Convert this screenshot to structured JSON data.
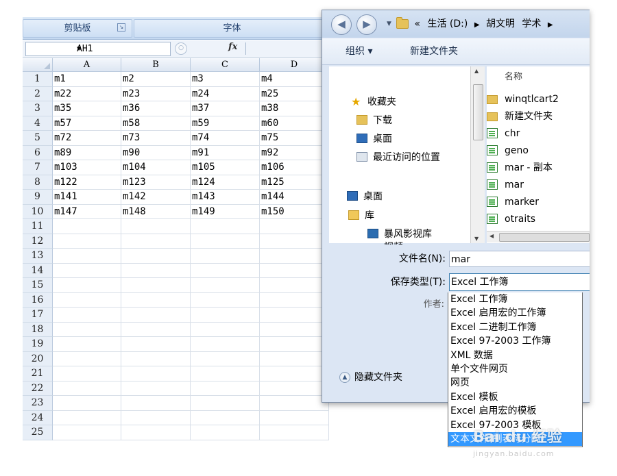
{
  "excel": {
    "ribbon": {
      "clipboard": "剪贴板",
      "font": "字体",
      "launcher_icon": "dialog-launcher-icon"
    },
    "name_box": "AH1",
    "fx_label": "fx",
    "columns": [
      "A",
      "B",
      "C",
      "D"
    ],
    "rows": [
      {
        "num": "1",
        "cells": [
          "m1",
          "m2",
          "m3",
          "m4"
        ]
      },
      {
        "num": "2",
        "cells": [
          "m22",
          "m23",
          "m24",
          "m25"
        ]
      },
      {
        "num": "3",
        "cells": [
          "m35",
          "m36",
          "m37",
          "m38"
        ]
      },
      {
        "num": "4",
        "cells": [
          "m57",
          "m58",
          "m59",
          "m60"
        ]
      },
      {
        "num": "5",
        "cells": [
          "m72",
          "m73",
          "m74",
          "m75"
        ]
      },
      {
        "num": "6",
        "cells": [
          "m89",
          "m90",
          "m91",
          "m92"
        ]
      },
      {
        "num": "7",
        "cells": [
          "m103",
          "m104",
          "m105",
          "m106"
        ]
      },
      {
        "num": "8",
        "cells": [
          "m122",
          "m123",
          "m124",
          "m125"
        ]
      },
      {
        "num": "9",
        "cells": [
          "m141",
          "m142",
          "m143",
          "m144"
        ]
      },
      {
        "num": "10",
        "cells": [
          "m147",
          "m148",
          "m149",
          "m150"
        ]
      },
      {
        "num": "11",
        "cells": [
          "",
          "",
          "",
          ""
        ]
      },
      {
        "num": "12",
        "cells": [
          "",
          "",
          "",
          ""
        ]
      },
      {
        "num": "13",
        "cells": [
          "",
          "",
          "",
          ""
        ]
      },
      {
        "num": "14",
        "cells": [
          "",
          "",
          "",
          ""
        ]
      },
      {
        "num": "15",
        "cells": [
          "",
          "",
          "",
          ""
        ]
      },
      {
        "num": "16",
        "cells": [
          "",
          "",
          "",
          ""
        ]
      },
      {
        "num": "17",
        "cells": [
          "",
          "",
          "",
          ""
        ]
      },
      {
        "num": "18",
        "cells": [
          "",
          "",
          "",
          ""
        ]
      },
      {
        "num": "19",
        "cells": [
          "",
          "",
          "",
          ""
        ]
      },
      {
        "num": "20",
        "cells": [
          "",
          "",
          "",
          ""
        ]
      },
      {
        "num": "21",
        "cells": [
          "",
          "",
          "",
          ""
        ]
      },
      {
        "num": "22",
        "cells": [
          "",
          "",
          "",
          ""
        ]
      },
      {
        "num": "23",
        "cells": [
          "",
          "",
          "",
          ""
        ]
      },
      {
        "num": "24",
        "cells": [
          "",
          "",
          "",
          ""
        ]
      },
      {
        "num": "25",
        "cells": [
          "",
          "",
          "",
          ""
        ]
      }
    ]
  },
  "dialog": {
    "breadcrumb": {
      "prefix": "«",
      "items": [
        "生活 (D:)",
        "胡文明",
        "学术"
      ]
    },
    "toolbar": {
      "organize": "组织 ▾",
      "new_folder": "新建文件夹"
    },
    "nav": {
      "favorites": "收藏夹",
      "downloads": "下载",
      "desktop_fav": "桌面",
      "recent": "最近访问的位置",
      "desktop": "桌面",
      "library": "库",
      "storm_video": "暴风影视库",
      "video": "视频"
    },
    "files_header": "名称",
    "files": [
      {
        "name": "winqtlcart2",
        "icon": "folder-icon"
      },
      {
        "name": "新建文件夹",
        "icon": "folder-icon"
      },
      {
        "name": "chr",
        "icon": "excel-file-icon"
      },
      {
        "name": "geno",
        "icon": "excel-file-icon"
      },
      {
        "name": "mar - 副本",
        "icon": "excel-file-icon"
      },
      {
        "name": "mar",
        "icon": "excel-file-icon"
      },
      {
        "name": "marker",
        "icon": "excel-file-icon"
      },
      {
        "name": "otraits",
        "icon": "excel-file-icon"
      }
    ],
    "filename_label": "文件名(N):",
    "filename_value": "mar",
    "type_label": "保存类型(T):",
    "type_value": "Excel 工作簿",
    "author_label": "作者:",
    "hide_folders": "隐藏文件夹",
    "type_options": [
      "Excel 工作簿",
      "Excel 启用宏的工作簿",
      "Excel 二进制工作簿",
      "Excel 97-2003 工作簿",
      "XML 数据",
      "单个文件网页",
      "网页",
      "Excel 模板",
      "Excel 启用宏的模板",
      "Excel 97-2003 模板",
      "文本文件(制表符分隔)"
    ],
    "selected_option_index": 10
  },
  "watermark": {
    "main": "Bai du 经验",
    "sub": "jingyan.baidu.com"
  },
  "colors": {
    "selection": "#3399ff",
    "ribbon": "#c5d9f1",
    "dialog_frame": "#dce6f4"
  }
}
